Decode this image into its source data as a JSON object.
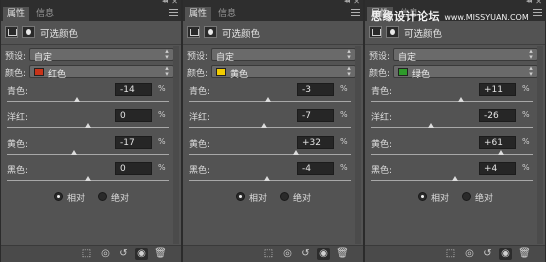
{
  "tabs": {
    "properties": "属性",
    "info": "信息"
  },
  "header_title": "可选颜色",
  "preset_label": "预设:",
  "preset_value": "自定",
  "color_label": "颜色:",
  "slider_names": [
    "青色:",
    "洋红:",
    "黄色:",
    "黑色:"
  ],
  "percent": "%",
  "method": {
    "relative": "相对",
    "absolute": "绝对",
    "selected": "relative"
  },
  "panels": [
    {
      "color_name": "红色",
      "swatch": "#c8341a",
      "values": [
        "-14",
        "0",
        "-17",
        "0"
      ],
      "levels": [
        -14,
        0,
        -17,
        0
      ]
    },
    {
      "color_name": "黄色",
      "swatch": "#f2cc00",
      "values": [
        "-3",
        "-7",
        "+32",
        "-4"
      ],
      "levels": [
        -3,
        -7,
        32,
        -4
      ]
    },
    {
      "color_name": "绿色",
      "swatch": "#2e9a2a",
      "values": [
        "+11",
        "-26",
        "+61",
        "+4"
      ],
      "levels": [
        11,
        -26,
        61,
        4
      ]
    }
  ],
  "watermark": {
    "text": "思缘设计论坛",
    "url": "www.MISSYUAN.COM"
  },
  "icons": [
    "clip-to-layer-icon",
    "view-previous-icon",
    "reset-icon",
    "visibility-icon",
    "delete-icon"
  ]
}
